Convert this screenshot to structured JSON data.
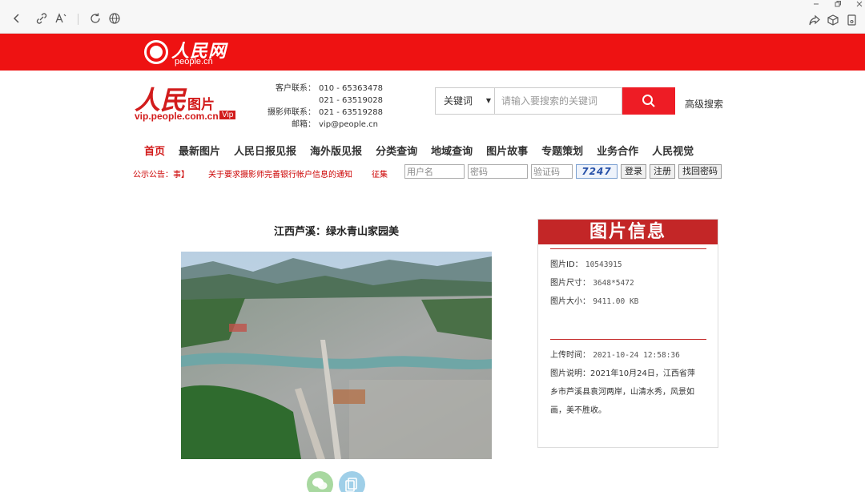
{
  "browser": {
    "icons": [
      "back-icon",
      "link-icon",
      "read-aloud-icon",
      "refresh-icon",
      "globe-icon",
      "share-icon",
      "extensions-icon",
      "screenshot-icon"
    ],
    "window_controls": [
      "minimize-icon",
      "restore-icon",
      "close-icon"
    ]
  },
  "banner": {
    "logo_cn": "人民网",
    "logo_en": "people.cn",
    "color": "#ee1212"
  },
  "site": {
    "logo_main": "人民",
    "logo_sub": "图片",
    "logo_url": "vip.people.com.cn",
    "logo_badge": "Vip",
    "contacts": [
      {
        "label": "客户联系：",
        "value": "010 - 65363478"
      },
      {
        "label": "",
        "value": "021 - 63519028"
      },
      {
        "label": "摄影师联系：",
        "value": "021 - 63519288"
      },
      {
        "label": "邮箱：",
        "value": "vip@people.cn"
      }
    ]
  },
  "search": {
    "select_value": "关键词",
    "placeholder": "请输入要搜索的关键词",
    "advanced": "高级搜索",
    "accent": "#ee1c25"
  },
  "nav": {
    "items": [
      "首页",
      "最新图片",
      "人民日报见报",
      "海外版见报",
      "分类查询",
      "地域查询",
      "图片故事",
      "专题策划",
      "业务合作",
      "人民视觉"
    ],
    "active_index": 0
  },
  "notice": {
    "label": "公示公告：事】",
    "text": "关于要求摄影师完善银行帐户信息的通知",
    "extra": "征集"
  },
  "login": {
    "username_placeholder": "用户名",
    "password_placeholder": "密码",
    "captcha_placeholder": "验证码",
    "captcha_code": "7247",
    "login": "登录",
    "register": "注册",
    "recover": "找回密码"
  },
  "photo": {
    "title": "江西芦溪：绿水青山家园美"
  },
  "info": {
    "header": "图片信息",
    "id_label": "图片ID：",
    "id_value": "10543915",
    "size_label": "图片尺寸：",
    "size_value": "3648*5472",
    "filesize_label": "图片大小：",
    "filesize_value": "9411.00 KB",
    "upload_label": "上传时间：",
    "upload_value": "2021-10-24 12:58:36",
    "desc_label": "图片说明：",
    "desc_lines": [
      "2021年10月24日，江西省萍",
      "乡市芦溪县袁河两岸，山清水秀，风景如",
      "画，美不胜收。"
    ],
    "accent": "#c32627"
  },
  "share": {
    "icons": [
      "wechat-icon",
      "copy-icon"
    ]
  }
}
